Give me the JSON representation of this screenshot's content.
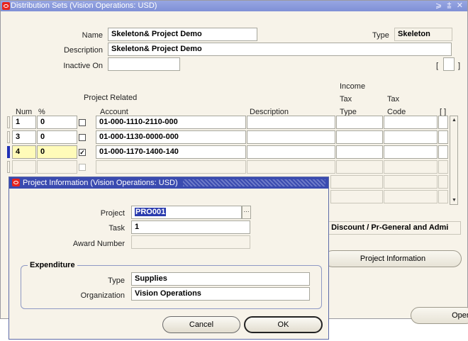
{
  "window": {
    "title": "Distribution Sets (Vision Operations: USD)",
    "controls": "⩾ ⩲ ✕"
  },
  "header": {
    "name_label": "Name",
    "name_value": "Skeleton& Project Demo",
    "type_label": "Type",
    "type_value": "Skeleton",
    "description_label": "Description",
    "description_value": "Skeleton& Project Demo",
    "inactive_label": "Inactive On",
    "inactive_value": "",
    "bracket_left": "[",
    "bracket_right": "]"
  },
  "table": {
    "project_related_label": "Project Related",
    "headers": {
      "num": "Num",
      "pct": "%",
      "account": "Account",
      "description": "Description",
      "income_tax_type": [
        "Income",
        "Tax",
        "Type"
      ],
      "tax_code": [
        "Tax",
        "Code"
      ],
      "folder": "[ ]"
    },
    "rows": [
      {
        "num": "1",
        "pct": "0",
        "project_related": false,
        "account": "01-000-1110-2110-000",
        "description": "",
        "tax_type": "",
        "tax_code": ""
      },
      {
        "num": "3",
        "pct": "0",
        "project_related": false,
        "account": "01-000-1130-0000-000",
        "description": "",
        "tax_type": "",
        "tax_code": ""
      },
      {
        "num": "4",
        "pct": "0",
        "project_related": true,
        "account": "01-000-1170-1400-140",
        "description": "",
        "tax_type": "",
        "tax_code": ""
      },
      {
        "num": "",
        "pct": "",
        "project_related": false,
        "account": "",
        "description": "",
        "tax_type": "",
        "tax_code": ""
      }
    ]
  },
  "background_partial": {
    "discount_text": "I Discount / Pr-General and Admi",
    "project_info_button": "Project Information",
    "open_button_partial": "Open"
  },
  "dialog": {
    "title": "Project Information (Vision Operations: USD)",
    "project_label": "Project",
    "project_value": "PRO001",
    "task_label": "Task",
    "task_value": "1",
    "award_label": "Award Number",
    "award_value": "",
    "expenditure_label": "Expenditure",
    "type_label": "Type",
    "type_value": "Supplies",
    "org_label": "Organization",
    "org_value": "Vision Operations",
    "cancel_button": "Cancel",
    "ok_button": "OK"
  },
  "colors": {
    "titlebar": "#8a9bdc",
    "dialog_titlebar": "#3a4bb0",
    "current_row_indicator": "#2130b5",
    "current_row_field": "#fffbb9",
    "canvas": "#f7f3e9"
  },
  "icons": {
    "app_icon": "oracle-o-icon",
    "lov": "ellipsis-icon",
    "scroll_up": "triangle-up-icon",
    "scroll_down": "triangle-down-icon"
  }
}
